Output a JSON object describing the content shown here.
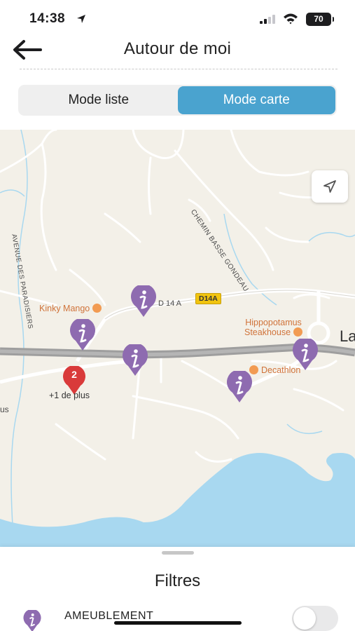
{
  "status_bar": {
    "time": "14:38",
    "battery": "70"
  },
  "header": {
    "title": "Autour de moi"
  },
  "segmented": {
    "list_label": "Mode liste",
    "map_label": "Mode carte",
    "selected": "Mode carte"
  },
  "map": {
    "roads": {
      "d14a": "D 14 A",
      "d14a_badge": "D14A",
      "chemin": "CHEMIN BASSE GONDEAU",
      "avenue": "AVENUE DES PARADISIERS"
    },
    "places": {
      "kinky_mango": "Kinky Mango",
      "hippo_line1": "Hippopotamus",
      "hippo_line2": "Steakhouse",
      "decathlon": "Decathlon",
      "edge_left": "us",
      "edge_right": "La"
    },
    "cluster": {
      "count": "2",
      "more": "+1 de plus"
    },
    "colors": {
      "marker": "#8e6bb0",
      "cluster": "#d93a3a",
      "water": "#a8d8f0",
      "road_main": "#9e9e9e"
    },
    "icons": {
      "marker": "info-marker-icon",
      "locate": "locate-arrow-icon"
    }
  },
  "sheet": {
    "title": "Filtres",
    "filter_label": "AMEUBLEMENT",
    "toggle_on": false
  }
}
